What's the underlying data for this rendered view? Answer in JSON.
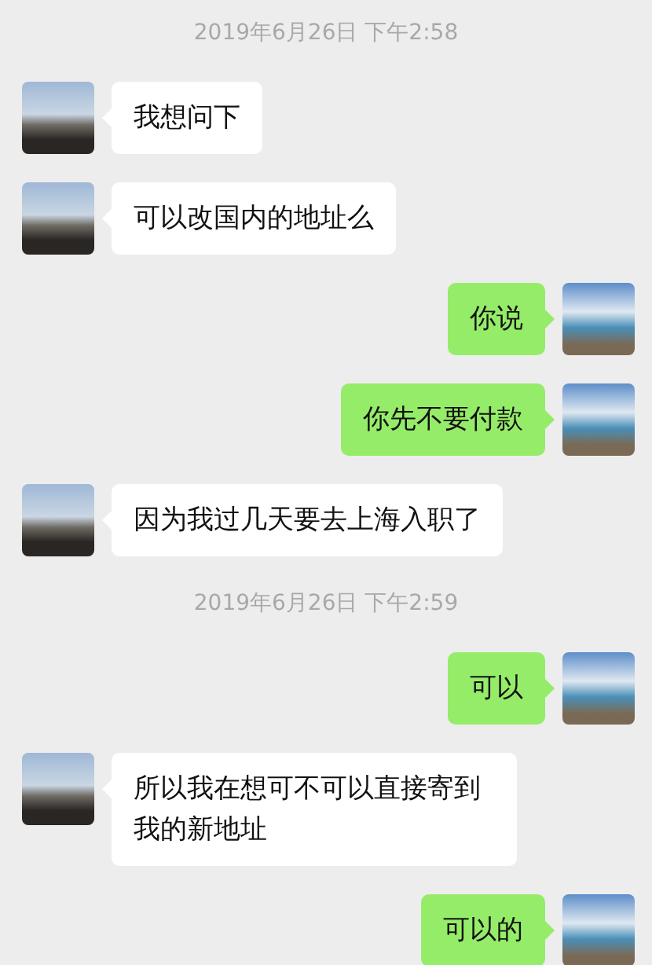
{
  "chat": [
    {
      "kind": "timestamp",
      "text": "2019年6月26日 下午2:58"
    },
    {
      "kind": "incoming",
      "text": "我想问下"
    },
    {
      "kind": "incoming",
      "text": "可以改国内的地址么"
    },
    {
      "kind": "outgoing",
      "text": "你说"
    },
    {
      "kind": "outgoing",
      "text": "你先不要付款"
    },
    {
      "kind": "incoming",
      "text": "因为我过几天要去上海入职了"
    },
    {
      "kind": "timestamp",
      "text": "2019年6月26日 下午2:59"
    },
    {
      "kind": "outgoing",
      "text": "可以"
    },
    {
      "kind": "incoming",
      "text": "所以我在想可不可以直接寄到我的新地址"
    },
    {
      "kind": "outgoing",
      "text": "可以的"
    }
  ]
}
